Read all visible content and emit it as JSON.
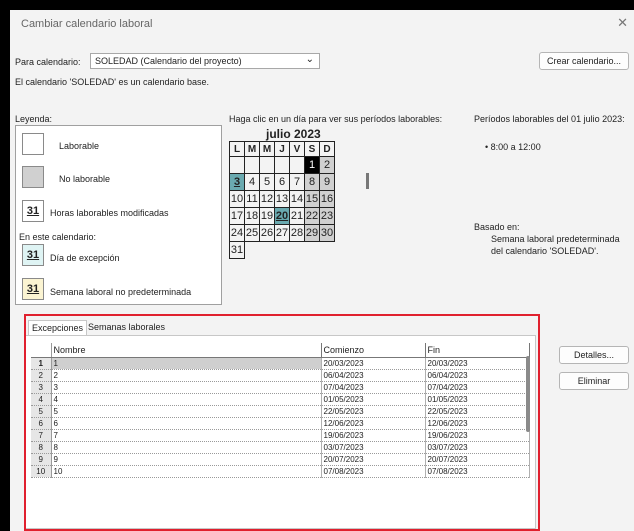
{
  "window": {
    "title": "Cambiar calendario laboral",
    "close_glyph": "✕"
  },
  "calendar_select": {
    "label": "Para calendario:",
    "value": "SOLEDAD (Calendario del proyecto)",
    "arrow": "⌄"
  },
  "create_button": "Crear calendario...",
  "base_note": "El calendario 'SOLEDAD' es un calendario base.",
  "legend": {
    "title": "Leyenda:",
    "working": "Laborable",
    "nonworking": "No laborable",
    "modified_hours": "Horas laborables modificadas",
    "modified_num": "31",
    "in_calendar": "En este calendario:",
    "exception_day": "Día de excepción",
    "exception_num": "31",
    "nondefault_week": "Semana laboral no predeterminada",
    "nondefault_num": "31"
  },
  "calendar": {
    "hint": "Haga clic en un día para ver sus períodos laborables:",
    "month": "julio 2023",
    "weekdays": [
      "L",
      "M",
      "M",
      "J",
      "V",
      "S",
      "D"
    ],
    "weeks": [
      [
        "",
        "",
        "",
        "",
        "",
        "1",
        "2"
      ],
      [
        "3",
        "4",
        "5",
        "6",
        "7",
        "8",
        "9"
      ],
      [
        "10",
        "11",
        "12",
        "13",
        "14",
        "15",
        "16"
      ],
      [
        "17",
        "18",
        "19",
        "20",
        "21",
        "22",
        "23"
      ],
      [
        "24",
        "25",
        "26",
        "27",
        "28",
        "29",
        "30"
      ],
      [
        "31",
        "",
        "",
        "",
        "",
        "",
        ""
      ]
    ]
  },
  "periods": {
    "title": "Períodos laborables del 01 julio 2023:",
    "items": [
      "• 8:00 a 12:00"
    ],
    "based_on_label": "Basado en:",
    "based_on_line1": "Semana laboral predeterminada",
    "based_on_line2": "del calendario 'SOLEDAD'."
  },
  "tabs": [
    "Excepciones",
    "Semanas laborales"
  ],
  "grid": {
    "columns": [
      "Nombre",
      "Comienzo",
      "Fin"
    ],
    "rows": [
      {
        "n": "1",
        "name": "1",
        "start": "20/03/2023",
        "end": "20/03/2023"
      },
      {
        "n": "2",
        "name": "2",
        "start": "06/04/2023",
        "end": "06/04/2023"
      },
      {
        "n": "3",
        "name": "3",
        "start": "07/04/2023",
        "end": "07/04/2023"
      },
      {
        "n": "4",
        "name": "4",
        "start": "01/05/2023",
        "end": "01/05/2023"
      },
      {
        "n": "5",
        "name": "5",
        "start": "22/05/2023",
        "end": "22/05/2023"
      },
      {
        "n": "6",
        "name": "6",
        "start": "12/06/2023",
        "end": "12/06/2023"
      },
      {
        "n": "7",
        "name": "7",
        "start": "19/06/2023",
        "end": "19/06/2023"
      },
      {
        "n": "8",
        "name": "8",
        "start": "03/07/2023",
        "end": "03/07/2023"
      },
      {
        "n": "9",
        "name": "9",
        "start": "20/07/2023",
        "end": "20/07/2023"
      },
      {
        "n": "10",
        "name": "10",
        "start": "07/08/2023",
        "end": "07/08/2023"
      }
    ]
  },
  "details_button": "Detalles...",
  "delete_button": "Eliminar",
  "colors": {
    "highlight_box": "#e0202e",
    "exception_day": "#6aaab0",
    "selected_day": "#000000",
    "nonworking": "#d0d0d0"
  }
}
